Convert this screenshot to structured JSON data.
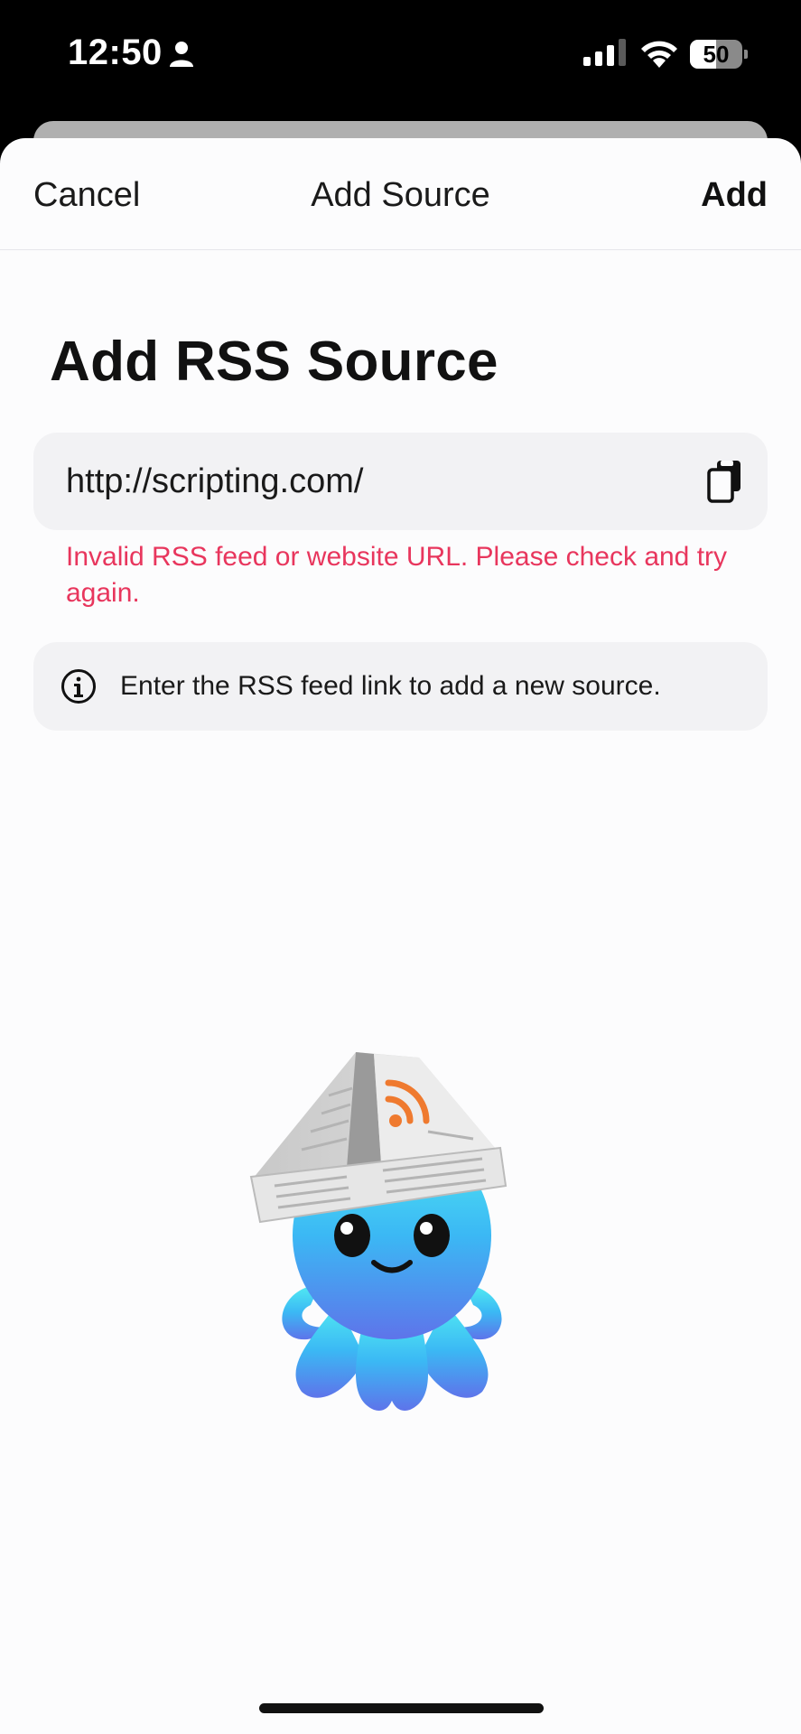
{
  "status_bar": {
    "time": "12:50",
    "battery_level": "50",
    "battery_fraction": 0.5
  },
  "nav": {
    "cancel_label": "Cancel",
    "title": "Add Source",
    "add_label": "Add"
  },
  "main": {
    "title": "Add RSS Source",
    "url_value": "http://scripting.com/",
    "error": "Invalid RSS feed or website URL. Please check and try again.",
    "info": "Enter the RSS feed link to add a new source."
  },
  "icons": {
    "status": [
      "person-icon",
      "signal-icon",
      "wifi-icon",
      "battery-icon"
    ],
    "field": "paste-icon",
    "info": "info-icon",
    "illustration": "octopus-rss-mascot"
  },
  "colors": {
    "error": "#e8365d",
    "field_background": "#f2f2f4",
    "rss_orange": "#ef7a2f",
    "mascot_blue": "#3bb8f4"
  }
}
